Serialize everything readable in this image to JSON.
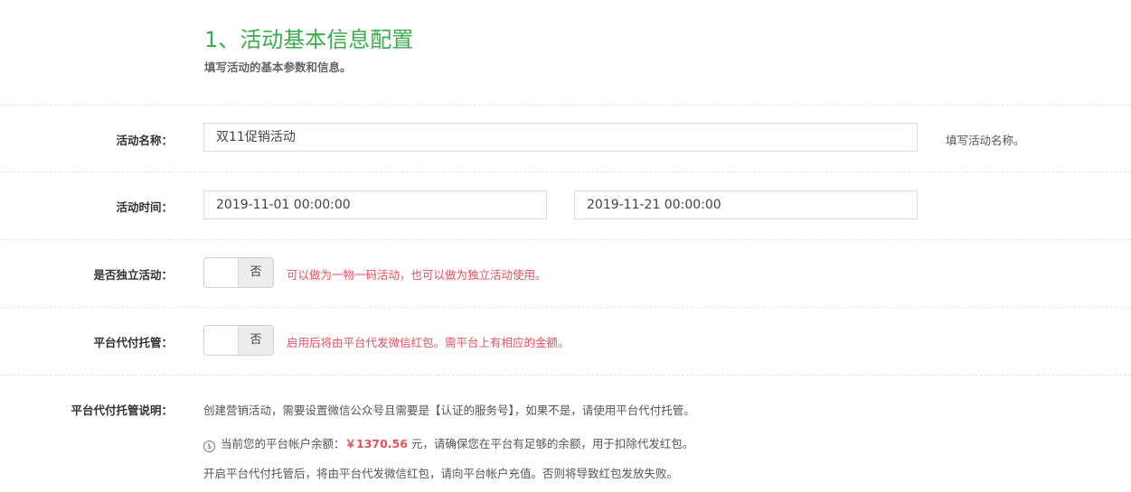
{
  "header": {
    "title": "1、活动基本信息配置",
    "subtitle": "填写活动的基本参数和信息。"
  },
  "colors": {
    "title_green": "#3cab4e",
    "warning_red": "#e4505f"
  },
  "activity_name": {
    "label": "活动名称：",
    "value": "双11促销活动",
    "help": "填写活动名称。"
  },
  "activity_time": {
    "label": "活动时间：",
    "start": "2019-11-01 00:00:00",
    "end": "2019-11-21 00:00:00"
  },
  "independent": {
    "label": "是否独立活动：",
    "toggle_text": "否",
    "note": "可以做为一物一码活动，也可以做为独立活动使用。"
  },
  "platform_hosting": {
    "label": "平台代付托管：",
    "toggle_text": "否",
    "note": "启用后将由平台代发微信红包。需平台上有相应的金额。"
  },
  "hosting_desc": {
    "label": "平台代付托管说明：",
    "line1": "创建营销活动，需要设置微信公众号且需要是【认证的服务号】，如果不是，请使用平台代付托管。",
    "coin_icon": "yuan-coin-icon",
    "line2_prefix": "当前您的平台帐户余额：",
    "amount": "￥1370.56",
    "line2_suffix": " 元，请确保您在平台有足够的余额，用于扣除代发红包。",
    "line3": "开启平台代付托管后，将由平台代发微信红包，请向平台帐户充值。否则将导致红包发放失败。"
  }
}
